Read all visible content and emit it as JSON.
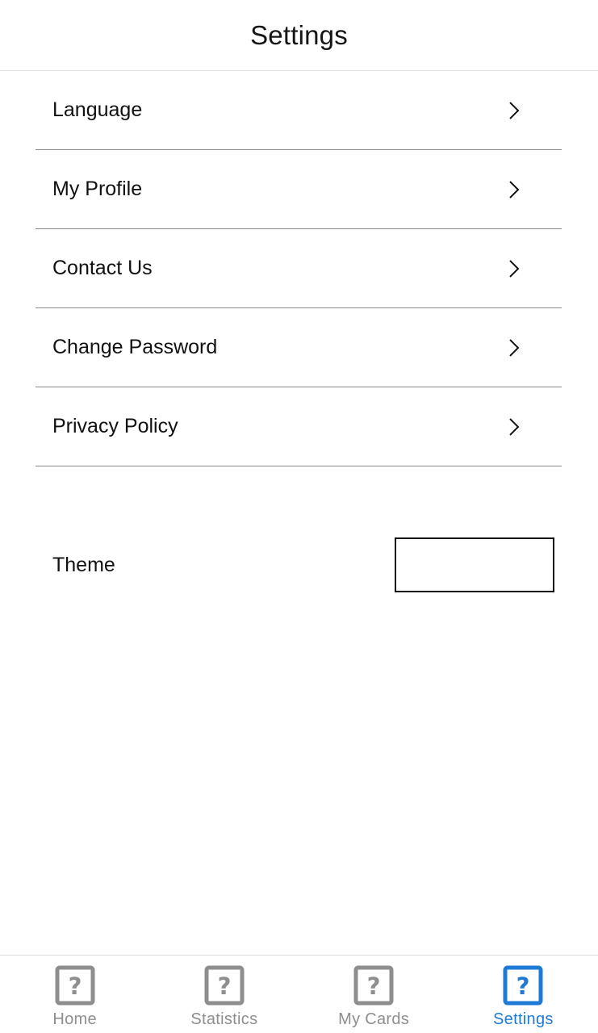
{
  "header": {
    "title": "Settings"
  },
  "menu": {
    "items": [
      {
        "label": "Language"
      },
      {
        "label": "My Profile"
      },
      {
        "label": "Contact Us"
      },
      {
        "label": "Change Password"
      },
      {
        "label": "Privacy Policy"
      }
    ]
  },
  "theme": {
    "label": "Theme",
    "value": ""
  },
  "tabbar": {
    "items": [
      {
        "label": "Home",
        "icon": "question-box-icon",
        "active": false
      },
      {
        "label": "Statistics",
        "icon": "question-box-icon",
        "active": false
      },
      {
        "label": "My Cards",
        "icon": "question-box-icon",
        "active": false
      },
      {
        "label": "Settings",
        "icon": "question-box-icon",
        "active": true
      }
    ],
    "colors": {
      "active": "#1f7ad6",
      "inactive": "#8e8e8e"
    }
  }
}
